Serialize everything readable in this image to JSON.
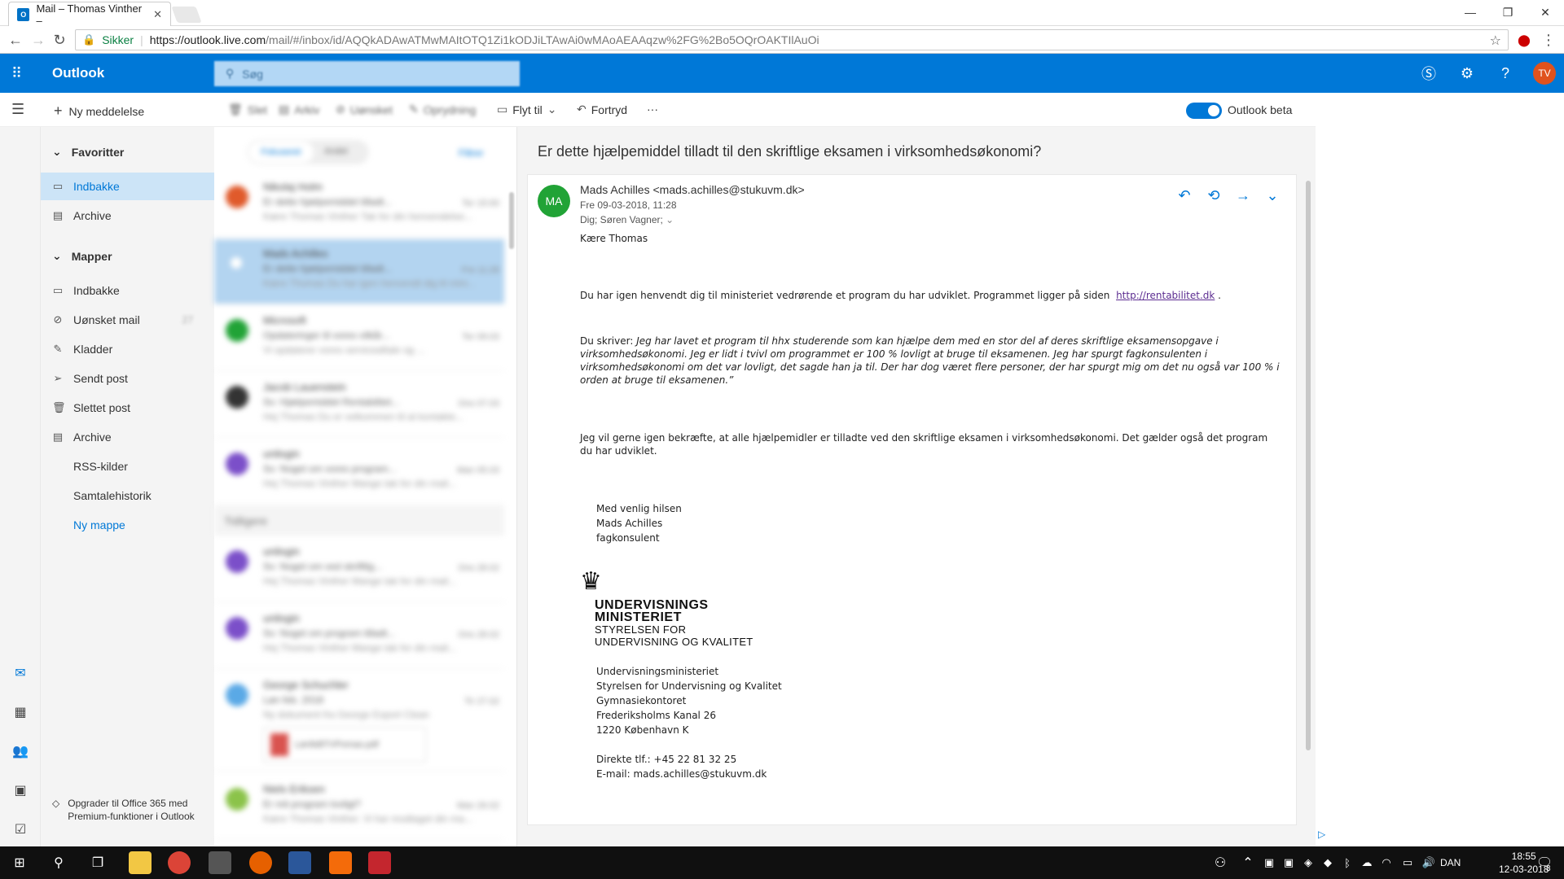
{
  "browser": {
    "tab_title": "Mail – Thomas Vinther –",
    "tab_favicon": "O",
    "secure_label": "Sikker",
    "url_host": "https://outlook.live.com",
    "url_path": "/mail/#/inbox/id/AQQkADAwATMwMAItOTQ1Zi1kODJiLTAwAi0wMAoAEAAqzw%2FG%2Bo5OQrOAKTIlAuOi"
  },
  "header": {
    "brand": "Outlook",
    "search_placeholder": "Søg",
    "avatar_initials": "TV",
    "accent": "#0078d7"
  },
  "commandbar": {
    "new_message": "Ny meddelelse",
    "delete": "Slet",
    "archive": "Arkiv",
    "junk": "Uønsket",
    "sweep": "Oprydning",
    "move_to": "Flyt til",
    "undo": "Fortryd",
    "more": "···",
    "beta_label": "Outlook beta"
  },
  "folders": {
    "favorites_label": "Favoritter",
    "favorites": [
      {
        "label": "Indbakke",
        "icon": "inbox-icon",
        "selected": true
      },
      {
        "label": "Archive",
        "icon": "archive-icon"
      }
    ],
    "folders_label": "Mapper",
    "items": [
      {
        "label": "Indbakke",
        "icon": "inbox-icon"
      },
      {
        "label": "Uønsket mail",
        "icon": "junk-icon",
        "count": "27"
      },
      {
        "label": "Kladder",
        "icon": "pencil-icon"
      },
      {
        "label": "Sendt post",
        "icon": "send-icon"
      },
      {
        "label": "Slettet post",
        "icon": "trash-icon"
      },
      {
        "label": "Archive",
        "icon": "archive-icon"
      },
      {
        "label": "RSS-kilder"
      },
      {
        "label": "Samtalehistorik"
      },
      {
        "label": "Ny mappe"
      }
    ],
    "upgrade_text": "Opgrader til Office 365 med Premium-funktioner i Outlook"
  },
  "messagelist": {
    "tab_focused": "Fokuseret",
    "tab_other": "Andet",
    "filter": "Filtrer",
    "group_label": "Tidligere",
    "rows": [
      {
        "from": "Nikolaj Holm",
        "subject": "Er dette hjælpemiddel tilladt...",
        "preview": "Kære Thomas Vinther Tak for din henvendelse...",
        "date": "Tor 15:00",
        "color": "#e05a2b"
      },
      {
        "from": "Mads Achilles",
        "subject": "Er dette hjælpemiddel tilladt...",
        "preview": "Kære Thomas Du har igen henvendt dig til mini...",
        "date": "Fre 11:28",
        "color": "#ffffff"
      },
      {
        "from": "Microsoft",
        "subject": "Opdateringer til vores vilkår...",
        "preview": "Vi opdaterer vores serviceaftale og ...",
        "date": "Tor 09.03",
        "color": "#21a336"
      },
      {
        "from": "Jacob Lauenstein",
        "subject": "Sv: Hjælpemiddel Rentabilitet...",
        "preview": "Hej Thomas Du er velkommen til at kontakte...",
        "date": "Ons 07.03",
        "color": "#333333"
      },
      {
        "from": "unilogin",
        "subject": "Sv: Noget om vores program...",
        "preview": "Hej Thomas Vinther Mange tak for din mail...",
        "date": "Man 05.03",
        "color": "#7b4fc9"
      },
      {
        "from": "unilogin",
        "subject": "Sv: Noget om ved skriftlig...",
        "preview": "Hej Thomas Vinther Mange tak for din mail...",
        "date": "Ons 28.02",
        "color": "#7b4fc9"
      },
      {
        "from": "unilogin",
        "subject": "Sv: Noget om program tilladt...",
        "preview": "Hej Thomas Vinther Mange tak for din mail...",
        "date": "Ons 28.02",
        "color": "#7b4fc9"
      },
      {
        "from": "George Schuchler",
        "subject": "Løn feb. 2018",
        "preview": "Ny dokument fra George Export Clean",
        "date": "Tir 27.02",
        "color": "#5aa9e6"
      },
      {
        "from": "Niels Eriksen",
        "subject": "Er mit program lovligt?",
        "preview": "Kære Thomas Vinther. Vi har modtaget din ma...",
        "date": "Man 26.02",
        "color": "#8bc34a"
      }
    ],
    "attachment_name": "LønfeBTVPomao.pdf"
  },
  "reading": {
    "subject": "Er dette hjælpemiddel tilladt til den skriftlige eksamen i virksomhedsøkonomi?",
    "avatar_initials": "MA",
    "avatar_color": "#21a336",
    "sender": "Mads Achilles <mads.achilles@stukuvm.dk>",
    "date": "Fre 09-03-2018, 11:28",
    "to": "Dig; Søren Vagner;",
    "greeting": "Kære Thomas",
    "p1_text": "Du har igen henvendt dig til ministeriet vedrørende et program du har udviklet. Programmet ligger på siden",
    "p1_link": "http://rentabilitet.dk",
    "p1_end": ".",
    "p2_lead": "Du skriver:",
    "p2_quote": "Jeg har lavet et program til hhx studerende som kan hjælpe dem med en stor del af deres skriftlige eksamensopgave i virksomhedsøkonomi. Jeg er lidt i tvivl om programmet er 100 % lovligt at bruge til eksamenen. Jeg har spurgt fagkonsulenten i virksomhedsøkonomi om det var lovligt, det sagde han ja til. Der har dog været flere personer, der har spurgt mig om det nu også var 100 % i orden at bruge til eksamenen.”",
    "p3": "Jeg vil gerne igen bekræfte, at alle hjælpemidler er tilladte ved den skriftlige eksamen i virksomhedsøkonomi. Det gælder også det program du har udviklet.",
    "sig_closing": "Med venlig hilsen",
    "sig_name": "Mads Achilles",
    "sig_title": "fagkonsulent",
    "logo_line1": "UNDERVISNINGS",
    "logo_line2": "MINISTERIET",
    "logo_line3": "STYRELSEN FOR",
    "logo_line4": "UNDERVISNING OG KVALITET",
    "addr1": "Undervisningsministeriet",
    "addr2": "Styrelsen for Undervisning og Kvalitet",
    "addr3": "Gymnasiekontoret",
    "addr4": "Frederiksholms Kanal 26",
    "addr5": "1220 København K",
    "phone": "Direkte tlf.: +45 22 81 32 25",
    "email": "E-mail: mads.achilles@stukuvm.dk"
  },
  "taskbar": {
    "lang": "DAN",
    "time": "18:55",
    "date": "12-03-2018",
    "notif_count": "3"
  }
}
